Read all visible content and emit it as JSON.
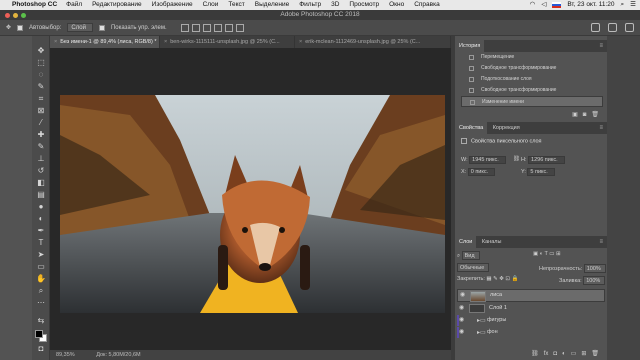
{
  "menubar": {
    "app_name": "Photoshop CC",
    "items": [
      "Файл",
      "Редактирование",
      "Изображение",
      "Слои",
      "Текст",
      "Выделение",
      "Фильтр",
      "3D",
      "Просмотр",
      "Окно",
      "Справка"
    ],
    "clock": "Вт, 23 окт. 11:20"
  },
  "window": {
    "title": "Adobe Photoshop CC 2018"
  },
  "options": {
    "autoselect_label": "Автовыбор:",
    "autoselect_value": "Слой",
    "show_controls_label": "Показать упр. элем."
  },
  "tabs": [
    {
      "label": "Без имени-1 @ 89,4% (лиса, RGB/8) *"
    },
    {
      "label": "ben-wirks-1115111-unsplash.jpg @ 25% (С..."
    },
    {
      "label": "erik-mclean-1112469-unsplash.jpg @ 25% (С..."
    }
  ],
  "status": {
    "zoom": "89,35%",
    "doc": "Док: 5,80M/20,6M"
  },
  "history": {
    "tab": "История",
    "items": [
      {
        "label": "Перемещение"
      },
      {
        "label": "Свободное трансформирование"
      },
      {
        "label": "Подоткосование слоя"
      },
      {
        "label": "Свободное трансформирование"
      },
      {
        "label": "Изменение имени"
      }
    ]
  },
  "properties": {
    "tabs": [
      "Свойства",
      "Коррекция"
    ],
    "title": "Свойства пиксельного слоя",
    "w": "1945 пикс.",
    "h": "1296 пикс.",
    "x": "0 пикс.",
    "y": "5 пикс."
  },
  "layers": {
    "tabs": [
      "Слои",
      "Каналы"
    ],
    "filter": "Вид",
    "blend": "Обычные",
    "opacity_label": "Непрозрачность:",
    "opacity": "100%",
    "lock_label": "Закрепить:",
    "fill_label": "Заливка:",
    "fill": "100%",
    "items": [
      {
        "name": "лиса"
      },
      {
        "name": "Слой 1"
      },
      {
        "name": "фигуры"
      },
      {
        "name": "фон"
      }
    ]
  }
}
